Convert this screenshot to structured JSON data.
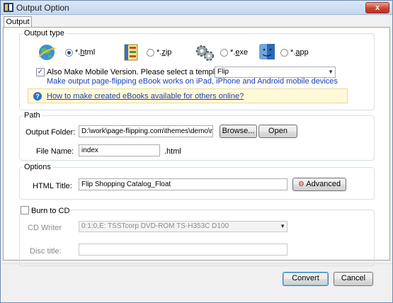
{
  "window": {
    "title": "Output Option",
    "close_glyph": "x"
  },
  "tab": {
    "label": "Output"
  },
  "output_type": {
    "legend": "Output type",
    "formats": [
      {
        "icon": "globe-html-icon",
        "label": "*.html",
        "hotkey_prefix": "*.",
        "hotkey": "h",
        "hotkey_suffix": "tml",
        "selected": true
      },
      {
        "icon": "zip-archive-icon",
        "label": "*.zip",
        "hotkey_prefix": "*.",
        "hotkey": "z",
        "hotkey_suffix": "ip",
        "selected": false
      },
      {
        "icon": "gears-exe-icon",
        "label": "*.exe",
        "hotkey_prefix": "*.",
        "hotkey": "e",
        "hotkey_suffix": "xe",
        "selected": false
      },
      {
        "icon": "mac-finder-icon",
        "label": "*.app",
        "hotkey_prefix": "*.",
        "hotkey": "a",
        "hotkey_suffix": "pp",
        "selected": false
      }
    ],
    "mobile_checkbox_checked": true,
    "mobile_label": "Also Make Mobile Version. Please select a template for mobile:",
    "mobile_template": "Flip",
    "mobile_note": "Make output page-flipping eBook works on iPad, iPhone and Android mobile devices",
    "help_link": "How to make created eBooks available for others online?"
  },
  "path": {
    "legend": "Path",
    "output_folder_label": "Output Folder:",
    "output_folder_value": "D:\\work\\page-flipping.com\\themes\\demo\\rabbit",
    "browse_label": "Browse...",
    "open_label": "Open",
    "file_name_label": "File Name:",
    "file_name_value": "index",
    "file_ext": ".html"
  },
  "options": {
    "legend": "Options",
    "html_title_label": "HTML Title:",
    "html_title_value": "Flip Shopping Catalog_Float",
    "advanced_label": "Advanced"
  },
  "burn": {
    "checkbox_checked": false,
    "label": "Burn to CD",
    "cd_writer_label": "CD Writer",
    "cd_writer_value": "0:1:0,E: TSSTcorp DVD-ROM TS-H353C D100",
    "disc_title_label": "Disc title:",
    "disc_title_value": ""
  },
  "footer": {
    "convert_label": "Convert",
    "cancel_label": "Cancel"
  }
}
